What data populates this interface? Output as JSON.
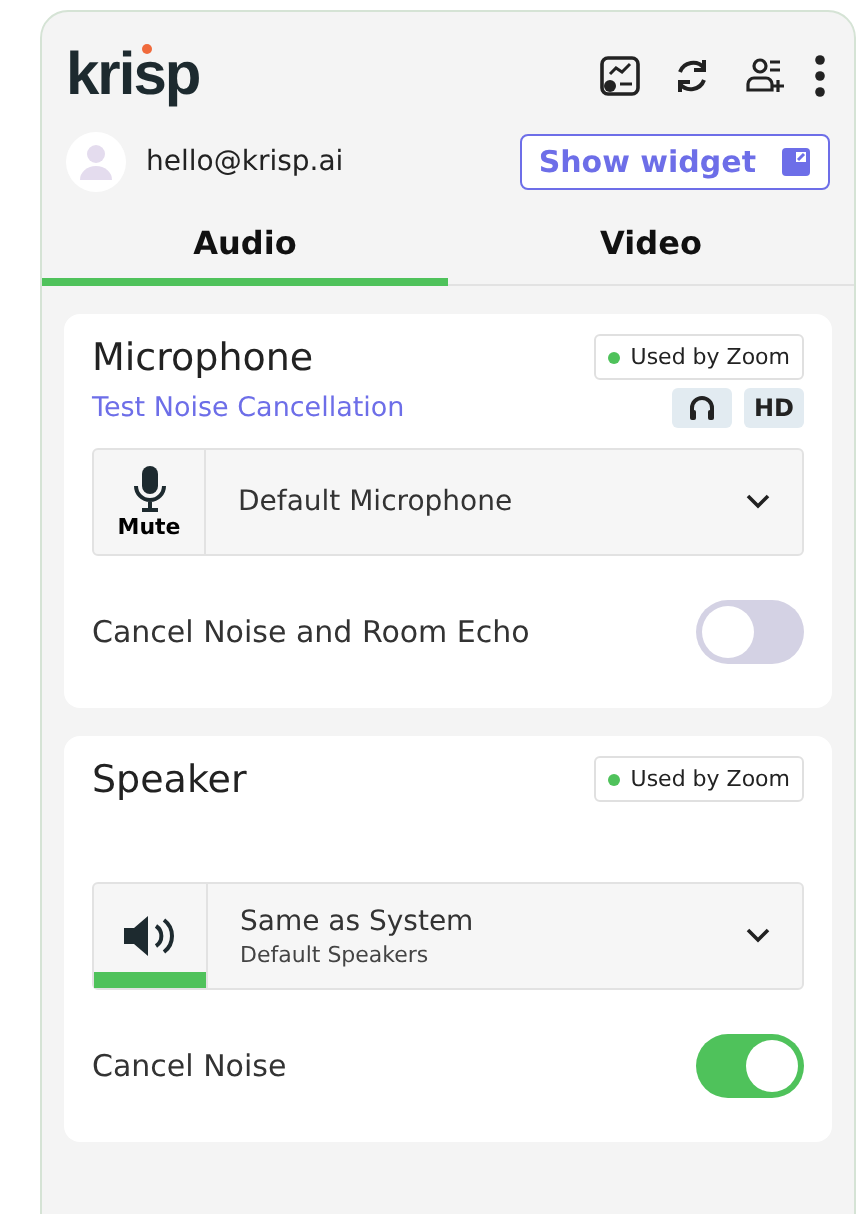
{
  "app": {
    "logo": "krisp"
  },
  "account": {
    "email": "hello@krisp.ai",
    "widget_button": "Show widget"
  },
  "tabs": [
    {
      "label": "Audio",
      "selected": true
    },
    {
      "label": "Video",
      "selected": false
    }
  ],
  "sections": [
    {
      "title": "Microphone",
      "status": "Used by Zoom",
      "link": "Test Noise Cancellation",
      "badges": [
        {
          "kind": "headphones"
        },
        {
          "kind": "text",
          "label": "HD"
        }
      ],
      "device": {
        "kind": "microphone",
        "button_label": "Mute",
        "name": "Default Microphone"
      },
      "toggle": {
        "label": "Cancel Noise and Room Echo",
        "on": false
      }
    },
    {
      "title": "Speaker",
      "status": "Used by Zoom",
      "device": {
        "kind": "speaker",
        "level": 1,
        "name": "Same as System",
        "subtitle": "Default Speakers"
      },
      "toggle": {
        "label": "Cancel Noise",
        "on": true
      }
    }
  ]
}
